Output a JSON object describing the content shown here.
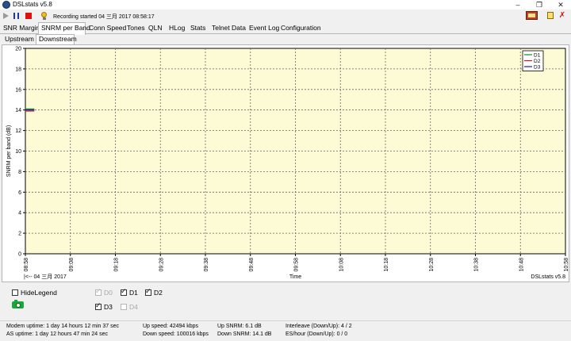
{
  "window": {
    "title": "DSLstats v5.8",
    "controls": [
      "–",
      "❐",
      "✕"
    ]
  },
  "toolbar": {
    "recording_status": "Recording started 04 三月 2017 08:58:17"
  },
  "tabs": [
    "SNR Margin",
    "SNRM per Band",
    "Conn Speed",
    "Tones",
    "QLN",
    "HLog",
    "Stats",
    "Telnet Data",
    "Event Log",
    "Configuration"
  ],
  "active_tab": "SNRM per Band",
  "subtabs": [
    "Upstream",
    "Downstream"
  ],
  "active_subtab": "Downstream",
  "colors": {
    "plot_background": "#fdfbd6",
    "grid": "#666666",
    "D1": "#0a8a2a",
    "D2": "#d01818",
    "D3": "#1a1ab0"
  },
  "chart_data": {
    "type": "line",
    "ylabel": "SNRM per band (dB)",
    "xlabel": "Time",
    "ylim": [
      0,
      20
    ],
    "y_ticks": [
      0,
      2,
      4,
      6,
      8,
      10,
      12,
      14,
      16,
      18,
      20
    ],
    "x_ticks": [
      "08:58",
      "09:08",
      "09:18",
      "09:28",
      "09:38",
      "09:48",
      "09:58",
      "10:08",
      "10:18",
      "10:28",
      "10:38",
      "10:48",
      "10:58"
    ],
    "date_label": "|<-- 04 三月 2017",
    "watermark": "DSLstats v5.8",
    "grid": true,
    "legend_position": "top-right",
    "series": [
      {
        "name": "D1",
        "x": [
          "08:58",
          "09:00"
        ],
        "values": [
          14.1,
          14.1
        ]
      },
      {
        "name": "D2",
        "x": [
          "08:58",
          "09:00"
        ],
        "values": [
          13.9,
          13.9
        ]
      },
      {
        "name": "D3",
        "x": [
          "08:58",
          "09:00"
        ],
        "values": [
          14.0,
          14.0
        ]
      }
    ]
  },
  "controls": {
    "hide_legend": {
      "label": "HideLegend",
      "checked": false
    },
    "bands": [
      {
        "label": "D0",
        "checked": true,
        "enabled": false
      },
      {
        "label": "D1",
        "checked": true,
        "enabled": true
      },
      {
        "label": "D2",
        "checked": true,
        "enabled": true
      },
      {
        "label": "D3",
        "checked": true,
        "enabled": true
      },
      {
        "label": "D4",
        "checked": false,
        "enabled": false
      }
    ]
  },
  "status": {
    "modem_uptime": "Modem uptime: 1 day 14 hours 12 min 37 sec",
    "as_uptime": "AS uptime: 1 day 12 hours 47 min 24 sec",
    "up_speed": "Up speed: 42494 kbps",
    "down_speed": "Down speed: 100016 kbps",
    "up_snrm": "Up SNRM: 6.1 dB",
    "down_snrm": "Down SNRM: 14.1 dB",
    "interleave": "Interleave (Down/Up): 4 / 2",
    "es_hour": "ES/hour (Down/Up): 0 / 0"
  }
}
